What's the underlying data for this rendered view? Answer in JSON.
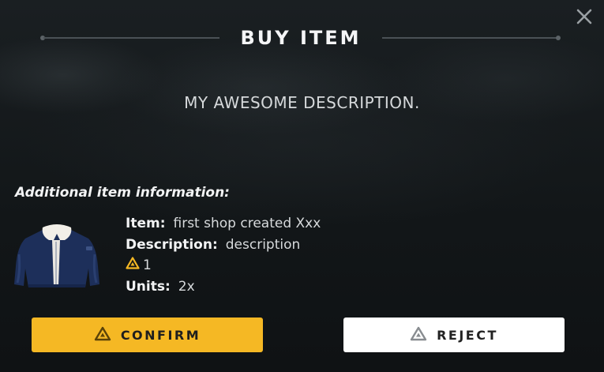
{
  "dialog": {
    "title": "BUY ITEM",
    "description": "MY AWESOME DESCRIPTION.",
    "additional_info_heading": "Additional item information:"
  },
  "item": {
    "name_label": "Item:",
    "name_value": "first shop created Xxx",
    "description_label": "Description:",
    "description_value": "description",
    "price_value": "1",
    "units_label": "Units:",
    "units_value": "2x",
    "image_icon": "jacket-icon"
  },
  "buttons": {
    "confirm_label": "CONFIRM",
    "reject_label": "REJECT"
  },
  "icons": {
    "close": "close-icon",
    "currency": "triangle-currency-icon"
  },
  "colors": {
    "accent": "#f5b824",
    "background": "#131719",
    "reject_bg": "#ffffff"
  }
}
